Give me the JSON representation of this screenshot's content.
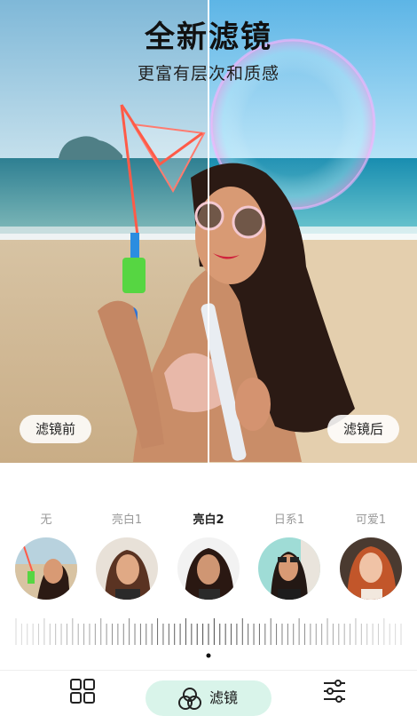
{
  "hero": {
    "title": "全新滤镜",
    "subtitle": "更富有层次和质感",
    "before_label": "滤镜前",
    "after_label": "滤镜后"
  },
  "filters": [
    {
      "label": "无",
      "selected": false
    },
    {
      "label": "亮白1",
      "selected": false
    },
    {
      "label": "亮白2",
      "selected": true
    },
    {
      "label": "日系1",
      "selected": false
    },
    {
      "label": "可爱1",
      "selected": false
    }
  ],
  "slider": {
    "value_fraction": 0.5
  },
  "bottom_nav": {
    "grid_icon": "grid-icon",
    "filter_icon": "filter-circles-icon",
    "filter_label": "滤镜",
    "adjust_icon": "sliders-icon"
  },
  "colors": {
    "accent_pill": "#d9f4ea",
    "sky_top": "#8fc3de",
    "sand": "#dcc6a4"
  }
}
